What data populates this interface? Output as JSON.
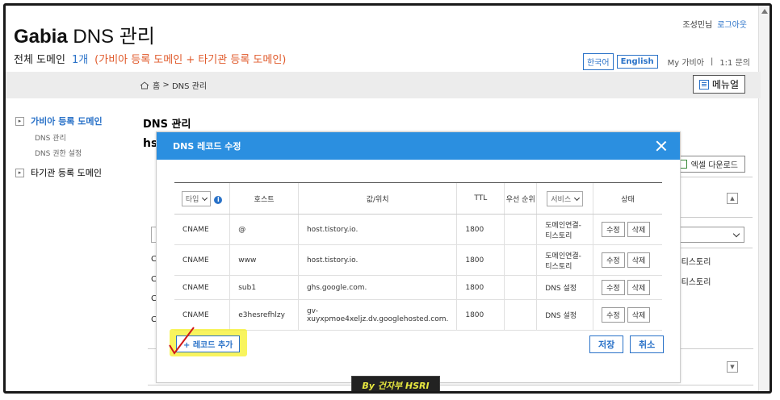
{
  "header": {
    "brand_bold": "Gabia",
    "brand_rest": " DNS 관리",
    "subtitle": "전체 도메인",
    "count": "1개",
    "count_note": "(가비아 등록 도메인 + 타기관 등록 도메인)",
    "user_name": "조성민님",
    "logout": "로그아웃",
    "lang_ko": "한국어",
    "lang_en": "English",
    "my_gabia": "My 가비아",
    "sep": "|",
    "one_to_one": "1:1 문의"
  },
  "breadcrumb": {
    "home": "홈",
    "sep": ">",
    "current": "DNS 관리"
  },
  "menu_button": "메뉴얼",
  "sidebar": {
    "section1": "가비아 등록 도메인",
    "sub1": "DNS 관리",
    "sub2": "DNS 권한 설정",
    "section2": "타기관 등록 도메인"
  },
  "main": {
    "title": "DNS 관리",
    "domain_prefix": "hs",
    "excel_button": "엑셀 다운로드",
    "bg_service1": "-티스토리",
    "bg_service2": "-티스토리",
    "bg_col_letter": "C"
  },
  "modal": {
    "title": "DNS 레코드 수정",
    "columns": {
      "type": "타입",
      "host": "호스트",
      "value": "값/위치",
      "ttl": "TTL",
      "priority": "우선 순위",
      "service": "서비스",
      "status": "상태"
    },
    "rows": [
      {
        "type": "CNAME",
        "host": "@",
        "value": "host.tistory.io.",
        "ttl": "1800",
        "priority": "",
        "service": "도메인연결-티스토리",
        "edit": "수정",
        "delete": "삭제"
      },
      {
        "type": "CNAME",
        "host": "www",
        "value": "host.tistory.io.",
        "ttl": "1800",
        "priority": "",
        "service": "도메인연결-티스토리",
        "edit": "수정",
        "delete": "삭제"
      },
      {
        "type": "CNAME",
        "host": "sub1",
        "value": "ghs.google.com.",
        "ttl": "1800",
        "priority": "",
        "service": "DNS 설정",
        "edit": "수정",
        "delete": "삭제"
      },
      {
        "type": "CNAME",
        "host": "e3hesrefhlzy",
        "value": "gv-xuyxpmoe4xeljz.dv.googlehosted.com.",
        "ttl": "1800",
        "priority": "",
        "service": "DNS 설정",
        "edit": "수정",
        "delete": "삭제"
      }
    ],
    "add_record": "+ 레코드 추가",
    "save": "저장",
    "cancel": "취소"
  },
  "watermark": "By 건자부 HSRI",
  "colors": {
    "accent": "#2a72c8",
    "modal_header": "#2b8fe0",
    "note": "#e05a2b",
    "highlight": "#f5f028"
  }
}
